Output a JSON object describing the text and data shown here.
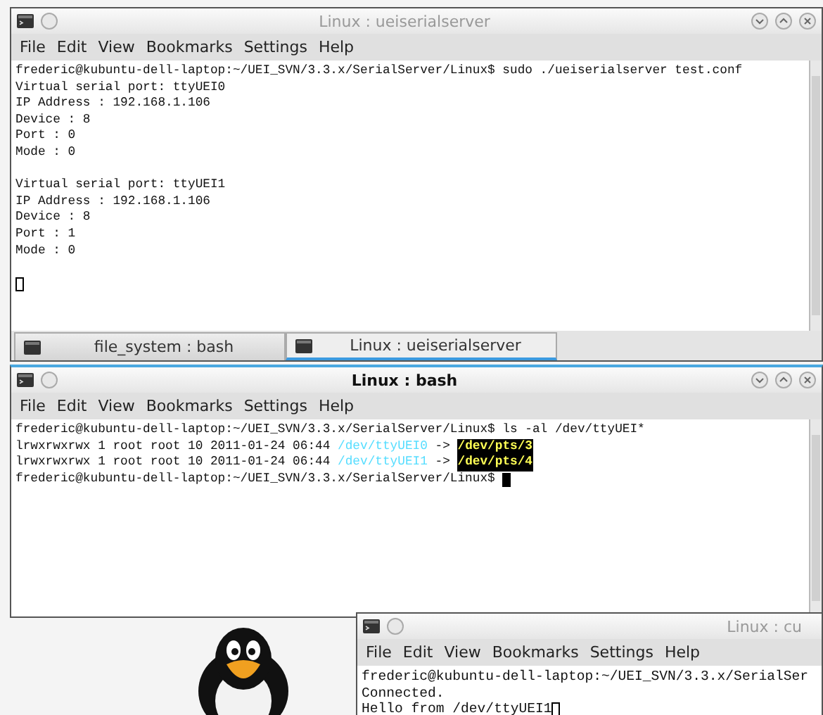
{
  "windows": [
    {
      "title": "Linux : ueiserialserver",
      "active": false,
      "menu": [
        "File",
        "Edit",
        "View",
        "Bookmarks",
        "Settings",
        "Help"
      ],
      "scrollbar": true,
      "lines": [
        {
          "segments": [
            {
              "kind": "plain",
              "text": "frederic@kubuntu-dell-laptop:~/UEI_SVN/3.3.x/SerialServer/Linux$ sudo ./ueiserialserver test.conf"
            }
          ]
        },
        {
          "segments": [
            {
              "kind": "plain",
              "text": "Virtual serial port: ttyUEI0"
            }
          ]
        },
        {
          "segments": [
            {
              "kind": "plain",
              "text": "IP Address : 192.168.1.106"
            }
          ]
        },
        {
          "segments": [
            {
              "kind": "plain",
              "text": "Device : 8"
            }
          ]
        },
        {
          "segments": [
            {
              "kind": "plain",
              "text": "Port : 0"
            }
          ]
        },
        {
          "segments": [
            {
              "kind": "plain",
              "text": "Mode : 0"
            }
          ]
        },
        {
          "segments": [
            {
              "kind": "plain",
              "text": "Virtual serial port: ttyUEI1"
            }
          ],
          "gap_before": true
        },
        {
          "segments": [
            {
              "kind": "plain",
              "text": "IP Address : 192.168.1.106"
            }
          ]
        },
        {
          "segments": [
            {
              "kind": "plain",
              "text": "Device : 8"
            }
          ]
        },
        {
          "segments": [
            {
              "kind": "plain",
              "text": "Port : 1"
            }
          ]
        },
        {
          "segments": [
            {
              "kind": "plain",
              "text": "Mode : 0"
            }
          ]
        },
        {
          "cursor": true,
          "gap_before": true
        }
      ],
      "tabs": [
        {
          "label": "file_system : bash",
          "selected": false
        },
        {
          "label": "Linux : ueiserialserver",
          "selected": true
        }
      ]
    },
    {
      "title": "Linux : bash",
      "active": true,
      "menu": [
        "File",
        "Edit",
        "View",
        "Bookmarks",
        "Settings",
        "Help"
      ],
      "scrollbar": true,
      "lines": [
        {
          "segments": [
            {
              "kind": "plain",
              "text": "frederic@kubuntu-dell-laptop:~/UEI_SVN/3.3.x/SerialServer/Linux$ ls -al /dev/ttyUEI*"
            }
          ]
        },
        {
          "segments": [
            {
              "kind": "plain",
              "text": "lrwxrwxrwx 1 root root 10 2011-01-24 06:44 "
            },
            {
              "kind": "link",
              "text": "/dev/ttyUEI0"
            },
            {
              "kind": "plain",
              "text": " -> "
            },
            {
              "kind": "highlight",
              "text": "/dev/pts/3"
            }
          ]
        },
        {
          "segments": [
            {
              "kind": "plain",
              "text": "lrwxrwxrwx 1 root root 10 2011-01-24 06:44 "
            },
            {
              "kind": "link",
              "text": "/dev/ttyUEI1"
            },
            {
              "kind": "plain",
              "text": " -> "
            },
            {
              "kind": "highlight",
              "text": "/dev/pts/4"
            }
          ]
        },
        {
          "segments": [
            {
              "kind": "plain",
              "text": "frederic@kubuntu-dell-laptop:~/UEI_SVN/3.3.x/SerialServer/Linux$ "
            }
          ],
          "cursor": true
        }
      ]
    },
    {
      "title": "Linux : cu",
      "active": false,
      "menu": [
        "File",
        "Edit",
        "View",
        "Bookmarks",
        "Settings",
        "Help"
      ],
      "lines": [
        {
          "segments": [
            {
              "kind": "plain",
              "text": "frederic@kubuntu-dell-laptop:~/UEI_SVN/3.3.x/SerialSer"
            }
          ]
        },
        {
          "segments": [
            {
              "kind": "plain",
              "text": "Connected."
            }
          ]
        },
        {
          "segments": [
            {
              "kind": "plain",
              "text": "Hello from /dev/ttyUEI1"
            }
          ],
          "cursor": true
        }
      ]
    }
  ]
}
